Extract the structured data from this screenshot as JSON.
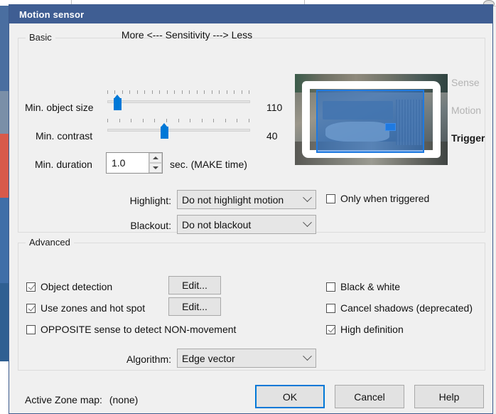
{
  "window": {
    "title": "Motion sensor"
  },
  "basic": {
    "legend": "Basic",
    "sensitivity_header": "More <--- Sensitivity ---> Less",
    "sliders": [
      {
        "label": "Min. object size",
        "value": "110",
        "percent": 7
      },
      {
        "label": "Min. contrast",
        "value": "40",
        "percent": 41
      }
    ],
    "duration": {
      "label": "Min. duration",
      "value": "1.0",
      "suffix": "sec.  (MAKE time)"
    },
    "highlight": {
      "label": "Highlight:",
      "value": "Do not highlight motion"
    },
    "blackout": {
      "label": "Blackout:",
      "value": "Do not blackout"
    },
    "only_when_triggered": {
      "label": "Only when triggered",
      "checked": false
    },
    "preview": {
      "labels": [
        {
          "text": "Sense",
          "active": false
        },
        {
          "text": "Motion",
          "active": false
        },
        {
          "text": "Trigger",
          "active": true
        }
      ]
    }
  },
  "advanced": {
    "legend": "Advanced",
    "left_checkboxes": [
      {
        "label": "Object detection",
        "checked": true
      },
      {
        "label": "Use zones and hot spot",
        "checked": true
      },
      {
        "label": "OPPOSITE sense to detect NON-movement",
        "checked": false
      }
    ],
    "right_checkboxes": [
      {
        "label": "Black & white",
        "checked": false
      },
      {
        "label": "Cancel shadows (deprecated)",
        "checked": false
      },
      {
        "label": "High definition",
        "checked": true
      }
    ],
    "edit_buttons": [
      {
        "label": "Edit..."
      },
      {
        "label": "Edit..."
      }
    ],
    "algorithm": {
      "label": "Algorithm:",
      "value": "Edge vector"
    }
  },
  "footer": {
    "zone_map_label": "Active Zone map:",
    "zone_map_value": "(none)",
    "buttons": [
      {
        "label": "OK",
        "default": true
      },
      {
        "label": "Cancel",
        "default": false
      },
      {
        "label": "Help",
        "default": false
      }
    ]
  },
  "colors": {
    "titlebar": "#3f5e93",
    "accent": "#0078d7",
    "dialog_bg": "#f0f0f0",
    "overlay_blue": "#1f7ae0"
  }
}
